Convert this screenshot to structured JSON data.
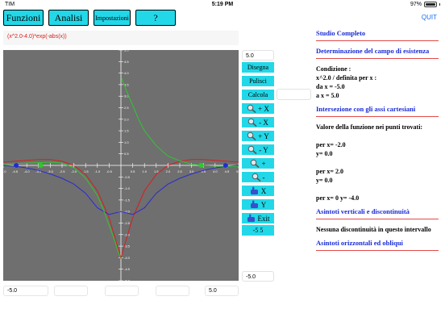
{
  "status": {
    "carrier": "TIM",
    "time": "5:19 PM",
    "battery": "97%",
    "battery_level": 0.97
  },
  "menu": {
    "funzioni": "Funzioni",
    "analisi": "Analisi",
    "impostazioni": "Impostazioni",
    "help": "?",
    "quit": "QUIT"
  },
  "formula": "(x^2.0-4.0)*exp(-abs(x))",
  "fields": {
    "ymax": "5.0",
    "ymin": "-5.0",
    "xmin": "-5.0",
    "xmax": "5.0",
    "extra": ""
  },
  "tools": {
    "disegna": "Disegna",
    "pulisci": "Pulisci",
    "calcola": "Calcola",
    "zoom_in_x": "+ X",
    "zoom_out_x": "- X",
    "zoom_in_y": "+ Y",
    "zoom_out_y": "- Y",
    "zoom_in": "+",
    "zoom_out": "-",
    "pan_x": "X",
    "pan_y": "Y",
    "exit": "Exit",
    "range": "-5  5"
  },
  "panel": {
    "studio": "Studio Completo",
    "dominio_title": "Determinazione del campo di esistenza",
    "condizione": "Condizione :",
    "condizione_expr": "x^2.0 / definita per x :",
    "da": "da x = -5.0",
    "a": "a x = 5.0",
    "intersezione_title": "Intersezione con gli assi cartesiani",
    "valore": "Valore della funzione nei punti trovati:",
    "p1x": "per x= -2.0",
    "p1y": "y= 0.0",
    "p2x": "per x= 2.0",
    "p2y": "y= 0.0",
    "p3": "per x= 0 y= -4.0",
    "asintoti_v_title": "Asintoti verticali e discontinuità",
    "nessuna": "Nessuna discontinuità in questo intervallo",
    "asintoti_o_title": "Asintoti orizzontali ed obliqui"
  },
  "chart_data": {
    "type": "line",
    "xlim": [
      -5,
      5
    ],
    "ylim": [
      -5,
      5
    ],
    "x_ticks": [
      "-5.0",
      "-4.5",
      "-4.0",
      "-3.5",
      "-3.0",
      "-2.5",
      "-2.0",
      "-1.5",
      "-1.0",
      "-0.5",
      "0.5",
      "1.0",
      "1.5",
      "2.0",
      "2.5",
      "3.0",
      "3.5",
      "4.0",
      "4.5",
      "5.0"
    ],
    "y_ticks": [
      "5.0",
      "4.5",
      "4.0",
      "3.5",
      "3.0",
      "2.5",
      "2.0",
      "1.5",
      "1.0",
      "0.5",
      "-0.5",
      "-1.0",
      "-1.5",
      "-2.0",
      "-2.5",
      "-3.0",
      "-3.5",
      "-4.0",
      "-4.5",
      "-5.0"
    ],
    "series": [
      {
        "name": "",
        "color": "#d81e1e",
        "x": [
          -5,
          -4.5,
          -4,
          -3.5,
          -3,
          -2.5,
          -2,
          -1.5,
          -1,
          -0.5,
          0,
          0.5,
          1,
          1.5,
          2,
          2.5,
          3,
          3.5,
          4,
          4.5,
          5
        ],
        "y": [
          0.14,
          0.18,
          0.22,
          0.25,
          0.25,
          0.18,
          0.0,
          -0.39,
          -1.1,
          -2.27,
          -4.0,
          -2.27,
          -1.1,
          -0.39,
          0.0,
          0.18,
          0.25,
          0.25,
          0.22,
          0.18,
          0.14
        ]
      },
      {
        "name": "",
        "color": "#2b2bd0",
        "x": [
          -5,
          -4.5,
          -4,
          -3.5,
          -3,
          -2.5,
          -2,
          -1.5,
          -1,
          -0.5,
          0,
          0.5,
          1,
          1.5,
          2,
          2.5,
          3,
          3.5,
          4,
          4.5,
          5
        ],
        "y": [
          0.0,
          -0.04,
          -0.11,
          -0.22,
          -0.37,
          -0.56,
          -0.81,
          -1.21,
          -1.84,
          -2.13,
          -2.0,
          -2.13,
          -1.84,
          -1.21,
          -0.81,
          -0.56,
          -0.37,
          -0.22,
          -0.11,
          -0.04,
          0.0
        ]
      },
      {
        "name": "",
        "color": "#2ec82e",
        "x": [
          0.02,
          0.1,
          0.25,
          0.5,
          0.75,
          1,
          1.5,
          2,
          2.5,
          3,
          3.5,
          4,
          4.5,
          5,
          -0.02,
          -0.1,
          -0.25,
          -0.5,
          -0.75,
          -1,
          -1.5,
          -2,
          -2.5,
          -3,
          -3.5,
          -4,
          -4.5,
          -5
        ],
        "y": [
          3.8,
          3.6,
          3.2,
          2.6,
          2.0,
          1.5,
          0.85,
          0.4,
          0.2,
          0.05,
          0.0,
          -0.03,
          -0.04,
          -0.04,
          -4.0,
          -3.8,
          -3.3,
          -2.6,
          -1.9,
          -1.3,
          -0.55,
          -0.1,
          0.1,
          0.14,
          0.12,
          0.1,
          0.08,
          0.06
        ]
      }
    ],
    "markers": [
      {
        "x": -4.45,
        "y": 0,
        "color": "#1f2ed0"
      },
      {
        "x": -3.4,
        "y": 0,
        "color": "#2ec82e"
      },
      {
        "x": 3.4,
        "y": 0,
        "color": "#2ec82e"
      },
      {
        "x": 4.45,
        "y": 0,
        "color": "#1f2ed0"
      }
    ]
  }
}
